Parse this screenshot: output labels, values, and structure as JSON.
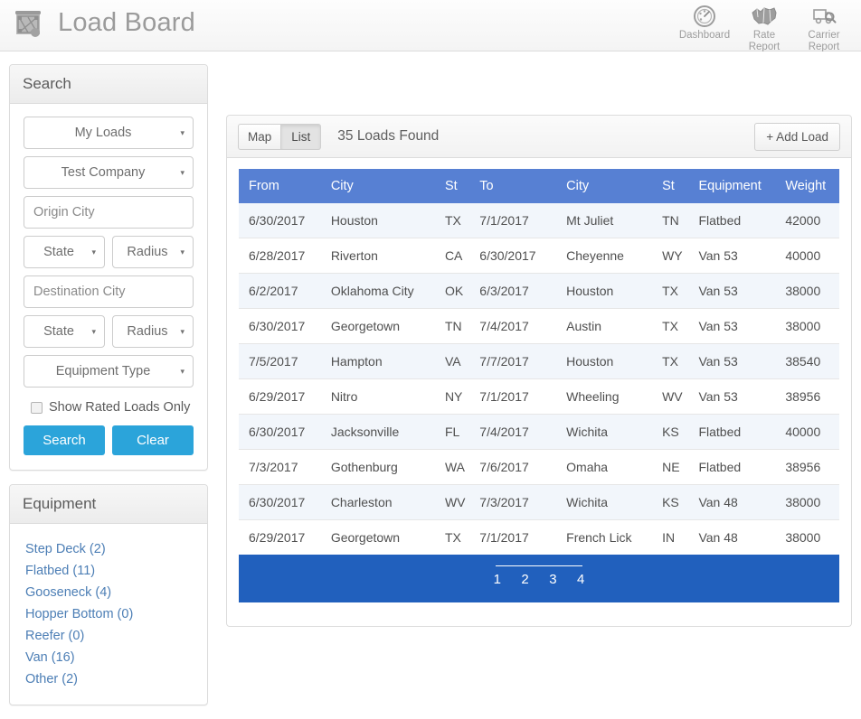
{
  "header": {
    "logo_icon": "flatbed-load-icon",
    "title": "Load Board",
    "nav": [
      {
        "icon": "gauge-icon",
        "line1": "Dashboard",
        "line2": ""
      },
      {
        "icon": "map-icon",
        "line1": "Rate",
        "line2": "Report"
      },
      {
        "icon": "truck-search-icon",
        "line1": "Carrier",
        "line2": "Report"
      }
    ]
  },
  "search_panel": {
    "title": "Search",
    "load_scope": {
      "value": "My Loads",
      "caret": "▾"
    },
    "company": {
      "value": "Test Company",
      "caret": "▾"
    },
    "origin_city_placeholder": "Origin City",
    "origin_state": {
      "value": "State",
      "caret": "▾"
    },
    "origin_radius": {
      "value": "Radius",
      "caret": "▾"
    },
    "destination_city_placeholder": "Destination City",
    "destination_state": {
      "value": "State",
      "caret": "▾"
    },
    "destination_radius": {
      "value": "Radius",
      "caret": "▾"
    },
    "equipment_type": {
      "value": "Equipment Type",
      "caret": "▾"
    },
    "rated_only_label": "Show Rated Loads Only",
    "rated_only_checked": false,
    "search_button": "Search",
    "clear_button": "Clear",
    "button_color": "#2ba4da"
  },
  "equipment_panel": {
    "title": "Equipment",
    "items": [
      {
        "label": "Step Deck (2)"
      },
      {
        "label": "Flatbed (11)"
      },
      {
        "label": "Gooseneck (4)"
      },
      {
        "label": "Hopper Bottom (0)"
      },
      {
        "label": "Reefer (0)"
      },
      {
        "label": "Van (16)"
      },
      {
        "label": "Other (2)"
      }
    ],
    "link_color": "#4c7eb5"
  },
  "toolbar": {
    "tabs": [
      {
        "label": "Map",
        "active": false
      },
      {
        "label": "List",
        "active": true
      }
    ],
    "results_text": "35 Loads Found",
    "add_load_label": "+ Add Load"
  },
  "table": {
    "header_color": "#5780d3",
    "columns": [
      "From",
      "City",
      "St",
      "To",
      "City",
      "St",
      "Equipment",
      "Weight"
    ],
    "rows": [
      {
        "from": "6/30/2017",
        "city1": "Houston",
        "st1": "TX",
        "to": "7/1/2017",
        "city2": "Mt Juliet",
        "st2": "TN",
        "equipment": "Flatbed",
        "weight": "42000"
      },
      {
        "from": "6/28/2017",
        "city1": "Riverton",
        "st1": "CA",
        "to": "6/30/2017",
        "city2": "Cheyenne",
        "st2": "WY",
        "equipment": "Van 53",
        "weight": "40000"
      },
      {
        "from": "6/2/2017",
        "city1": "Oklahoma City",
        "st1": "OK",
        "to": "6/3/2017",
        "city2": "Houston",
        "st2": "TX",
        "equipment": "Van 53",
        "weight": "38000"
      },
      {
        "from": "6/30/2017",
        "city1": "Georgetown",
        "st1": "TN",
        "to": "7/4/2017",
        "city2": "Austin",
        "st2": "TX",
        "equipment": "Van 53",
        "weight": "38000"
      },
      {
        "from": "7/5/2017",
        "city1": "Hampton",
        "st1": "VA",
        "to": "7/7/2017",
        "city2": "Houston",
        "st2": "TX",
        "equipment": "Van 53",
        "weight": "38540"
      },
      {
        "from": "6/29/2017",
        "city1": "Nitro",
        "st1": "NY",
        "to": "7/1/2017",
        "city2": "Wheeling",
        "st2": "WV",
        "equipment": "Van 53",
        "weight": "38956"
      },
      {
        "from": "6/30/2017",
        "city1": "Jacksonville",
        "st1": "FL",
        "to": "7/4/2017",
        "city2": "Wichita",
        "st2": "KS",
        "equipment": "Flatbed",
        "weight": "40000"
      },
      {
        "from": "7/3/2017",
        "city1": "Gothenburg",
        "st1": "WA",
        "to": "7/6/2017",
        "city2": "Omaha",
        "st2": "NE",
        "equipment": "Flatbed",
        "weight": "38956"
      },
      {
        "from": "6/30/2017",
        "city1": "Charleston",
        "st1": "WV",
        "to": "7/3/2017",
        "city2": "Wichita",
        "st2": "KS",
        "equipment": "Van 48",
        "weight": "38000"
      },
      {
        "from": "6/29/2017",
        "city1": "Georgetown",
        "st1": "TX",
        "to": "7/1/2017",
        "city2": "French Lick",
        "st2": "IN",
        "equipment": "Van 48",
        "weight": "38000"
      }
    ]
  },
  "pagination": {
    "background_color": "#2160bd",
    "pages": [
      "1",
      "2",
      "3",
      "4"
    ]
  }
}
